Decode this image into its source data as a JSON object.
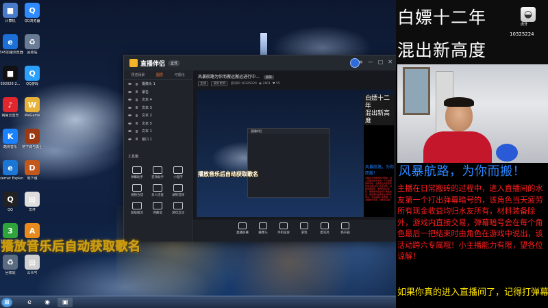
{
  "desktop": {
    "icons": [
      {
        "label": "计算机",
        "glyph": "■",
        "color": "#4a7bc8"
      },
      {
        "label": "QQ浏览器",
        "glyph": "Q",
        "color": "#2f89ff"
      },
      {
        "label": "2345加速浏览器",
        "glyph": "e",
        "color": "#1b6fd6"
      },
      {
        "label": "回收站",
        "glyph": "♻",
        "color": "#6a7c95"
      },
      {
        "label": "592026-2...",
        "glyph": "■",
        "color": "#111111"
      },
      {
        "label": "QQ游戏",
        "glyph": "Q",
        "color": "#2aa0ff"
      },
      {
        "label": "网易云音乐",
        "glyph": "♪",
        "color": "#e1262d"
      },
      {
        "label": "WeGame",
        "glyph": "W",
        "color": "#e7b33a"
      },
      {
        "label": "酷狗音乐",
        "glyph": "K",
        "color": "#1a82ff"
      },
      {
        "label": "地下城与勇士",
        "glyph": "D",
        "color": "#9b3a12"
      },
      {
        "label": "Internet Explorer",
        "glyph": "e",
        "color": "#1c76d6"
      },
      {
        "label": "地下城",
        "glyph": "D",
        "color": "#c4571b"
      },
      {
        "label": "QQ",
        "glyph": "Q",
        "color": "#222222"
      },
      {
        "label": "文件",
        "glyph": "▤",
        "color": "#dddddd"
      },
      {
        "label": "360安全卫士",
        "glyph": "3",
        "color": "#2ea43a"
      },
      {
        "label": "加速器",
        "glyph": "A",
        "color": "#e88a1e"
      },
      {
        "label": "回收站",
        "glyph": "♻",
        "color": "#5b6b80"
      },
      {
        "label": "公众号",
        "glyph": "▤",
        "color": "#cfcfcf"
      }
    ],
    "caption": "播放音乐后自动获取歌名"
  },
  "taskbar": {
    "start_glyph": "⊞",
    "buttons": [
      {
        "glyph": "e",
        "color": "#1c76d6"
      },
      {
        "glyph": "◉",
        "color": "#3b8ee8"
      },
      {
        "glyph": "▣",
        "color": "#f5a623"
      }
    ]
  },
  "app": {
    "name": "直播伴侣",
    "version": "正式",
    "tabs": [
      "预览场景",
      "图层",
      "可视化"
    ],
    "layers": [
      "摄像头 1",
      "歌名",
      "文本 4",
      "文本 3",
      "文本 2",
      "文本 5",
      "文本 1",
      "窗口 1"
    ],
    "tools_title": "工具箱",
    "tools": [
      "弹幕助手",
      "音效助手",
      "小程序",
      "视频合成",
      "多人连麦",
      "录制音频",
      "超级推流",
      "弹幕墙",
      "游戏互动"
    ],
    "room_title": "风暴航路为你而搬运搬运进行中...",
    "edit_tag": "编辑",
    "room_meta": {
      "chip1": "主播",
      "chip2": "最新更新",
      "room_id_label": "房间ID 10325224",
      "viewers": "2401",
      "likes": "55"
    },
    "preview_caption": "播放音乐后自动获取歌名",
    "bottom_actions": [
      "直播屏幕",
      "摄像头",
      "手机投屏",
      "游戏",
      "麦克风",
      "扬声器"
    ],
    "win_controls": [
      "≡",
      "—",
      "□",
      "✕"
    ]
  },
  "overlay": {
    "headline_1": "白嫖十二年",
    "headline_2": "混出新高度",
    "logo_text": "虎牙",
    "room_id": "10325224",
    "storm_line": "风暴航路，为你而搬！",
    "red_paragraph": "主播在日常搬砖的过程中，进入直播间的水友第一个打出弹幕暗号的，该角色当天疲劳所有现金收益均归水友所有，材料装备除外，游戏内直接交易，弹幕暗号会在每个角色最后一把结束时由角色在游戏中说出，该活动跨六专属哦！小主播能力有限，望各位谅解！",
    "yellow_line": "如果你真的进入直播间了，记得打弹幕参加哦"
  }
}
